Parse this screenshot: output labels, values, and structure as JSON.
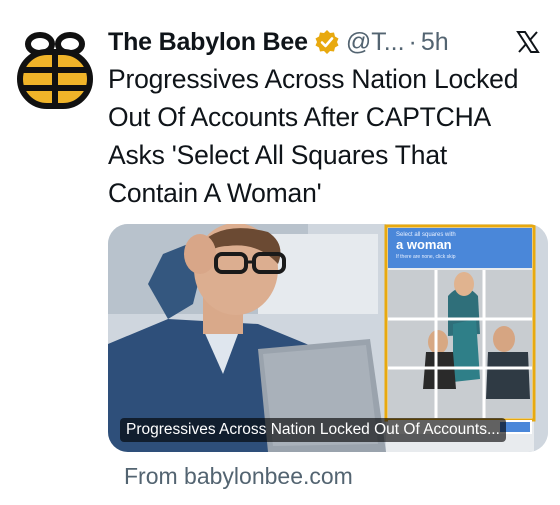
{
  "tweet": {
    "author_name": "The Babylon Bee",
    "handle": "@T...",
    "separator": "·",
    "time": "5h",
    "text": "Progressives Across Nation Locked Out Of Accounts After CAPTCHA Asks 'Select All Squares That Contain A Woman'",
    "icons": {
      "avatar": "babylon-bee-logo",
      "verified": "gold-verified-badge",
      "platform": "x-logo"
    }
  },
  "card": {
    "caption": "Progressives Across Nation Locked Out Of Accounts...",
    "captcha_line1": "Select all squares with",
    "captcha_line2": "a woman",
    "captcha_line3": "If there are none, click skip",
    "source": "From babylonbee.com"
  },
  "colors": {
    "accent_gold": "#e8a90f",
    "text": "#0f1419",
    "secondary": "#536471",
    "captcha_blue": "#4a87d9"
  }
}
